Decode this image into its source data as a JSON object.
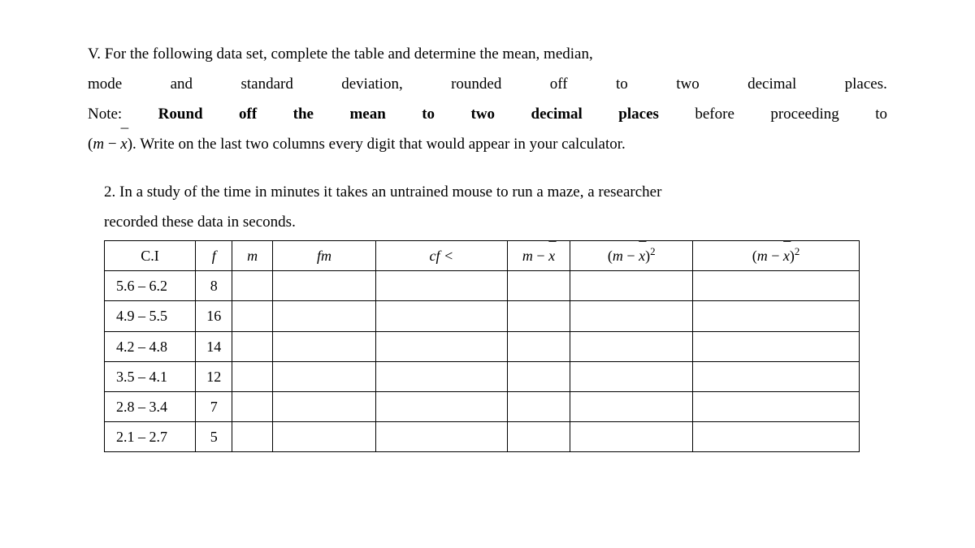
{
  "intro": {
    "l1_p1": "V. For the following data set, complete the table and determine the mean, median,",
    "l2_w1": "mode",
    "l2_w2": "and",
    "l2_w3": "standard",
    "l2_w4": "deviation,",
    "l2_w5": "rounded",
    "l2_w6": "off",
    "l2_w7": "to",
    "l2_w8": "two",
    "l2_w9": "decimal",
    "l2_w10": "places.",
    "l3_w1": "Note:",
    "l3_w2": "Round",
    "l3_w3": "off",
    "l3_w4": "the",
    "l3_w5": "mean",
    "l3_w6": "to",
    "l3_w7": "two",
    "l3_w8": "decimal",
    "l3_w9": "places",
    "l3_w10": "before",
    "l3_w11": "proceeding",
    "l3_w12": "to",
    "l4_p1": "(",
    "l4_m": "m",
    "l4_minus": " − ",
    "l4_x": "x",
    "l4_p2": "). Write on the last two columns every digit that would appear in your calculator."
  },
  "q2": {
    "text1": "2. In a study of the time in minutes it takes an untrained mouse to run a maze, a researcher",
    "text2": "recorded these data in seconds."
  },
  "headers": {
    "ci": "C.I",
    "f": "f",
    "m": "m",
    "fm": "fm",
    "cf": "cf <",
    "mx_m": "m",
    "mx_minus": " − ",
    "mx_x": "x",
    "mx2_open": "(",
    "mx2_m": "m",
    "mx2_minus": " − ",
    "mx2_x": "x",
    "mx2_close": ")",
    "mx2_sup": "2",
    "fmx2_open": "(",
    "fmx2_m": "m",
    "fmx2_minus": " − ",
    "fmx2_x": "x",
    "fmx2_close": ")",
    "fmx2_sup": "2"
  },
  "rows": {
    "r1_ci": "5.6 – 6.2",
    "r1_f": "8",
    "r2_ci": "4.9 – 5.5",
    "r2_f": "16",
    "r3_ci": "4.2 – 4.8",
    "r3_f": "14",
    "r4_ci": "3.5 – 4.1",
    "r4_f": "12",
    "r5_ci": "2.8 – 3.4",
    "r5_f": "7",
    "r6_ci": "2.1 – 2.7",
    "r6_f": "5"
  }
}
